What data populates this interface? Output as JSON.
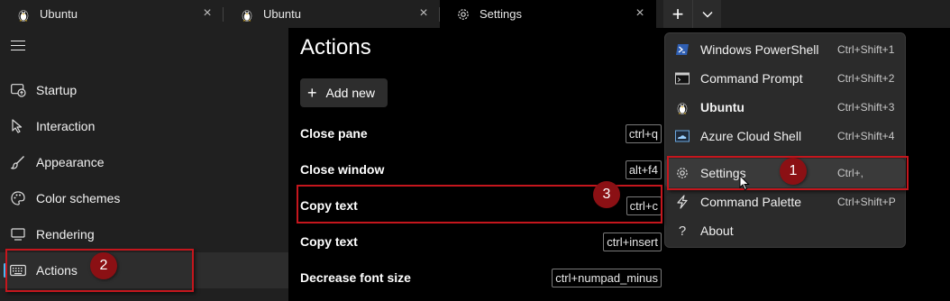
{
  "tabs": [
    {
      "title": "Ubuntu",
      "icon": "linux-tux-icon"
    },
    {
      "title": "Ubuntu",
      "icon": "linux-tux-icon"
    },
    {
      "title": "Settings",
      "icon": "gear-icon"
    }
  ],
  "tab_actions": {
    "new_tab": "+",
    "dropdown": "chevron-down-icon"
  },
  "sidebar": {
    "items": [
      {
        "label": "Startup",
        "icon": "startup-icon"
      },
      {
        "label": "Interaction",
        "icon": "interaction-cursor-icon"
      },
      {
        "label": "Appearance",
        "icon": "paintbrush-icon"
      },
      {
        "label": "Color schemes",
        "icon": "palette-icon"
      },
      {
        "label": "Rendering",
        "icon": "monitor-icon"
      },
      {
        "label": "Actions",
        "icon": "keyboard-icon",
        "selected": true
      }
    ]
  },
  "main": {
    "title": "Actions",
    "add_new_label": "Add new",
    "actions": [
      {
        "name": "Close pane",
        "key": "ctrl+q"
      },
      {
        "name": "Close window",
        "key": "alt+f4"
      },
      {
        "name": "Copy text",
        "key": "ctrl+c"
      },
      {
        "name": "Copy text",
        "key": "ctrl+insert"
      },
      {
        "name": "Decrease font size",
        "key": "ctrl+numpad_minus"
      }
    ]
  },
  "menu": {
    "items": [
      {
        "label": "Windows PowerShell",
        "shortcut": "Ctrl+Shift+1",
        "icon": "powershell-icon"
      },
      {
        "label": "Command Prompt",
        "shortcut": "Ctrl+Shift+2",
        "icon": "command-prompt-icon"
      },
      {
        "label": "Ubuntu",
        "shortcut": "Ctrl+Shift+3",
        "icon": "linux-tux-icon",
        "bold": true
      },
      {
        "label": "Azure Cloud Shell",
        "shortcut": "Ctrl+Shift+4",
        "icon": "azure-cloud-icon"
      },
      {
        "label": "Settings",
        "shortcut": "Ctrl+,",
        "icon": "gear-icon",
        "hover": true
      },
      {
        "label": "Command Palette",
        "shortcut": "Ctrl+Shift+P",
        "icon": "lightning-icon"
      },
      {
        "label": "About",
        "shortcut": "",
        "icon": "question-mark-icon"
      }
    ]
  },
  "annotations": {
    "badges": [
      "1",
      "2",
      "3"
    ],
    "highlight_color": "#c5161d",
    "badge_color": "#8b1014"
  },
  "colors": {
    "accent": "#4cc2ff",
    "sidebar_bg": "#202020",
    "menu_bg": "#2b2b2b"
  }
}
